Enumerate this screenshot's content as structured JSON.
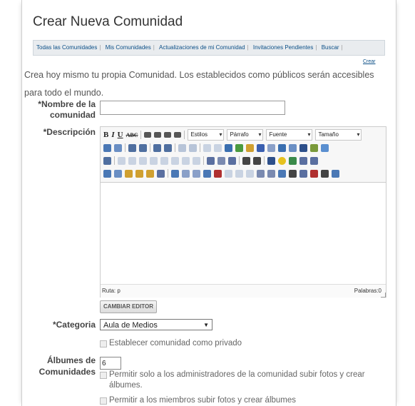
{
  "page": {
    "title": "Crear Nueva Comunidad",
    "tabs": [
      {
        "label": "Todas las Comunidades"
      },
      {
        "label": "Mis Comunidades"
      },
      {
        "label": "Actualizaciones de mi Comunidad"
      },
      {
        "label": "Invitaciones Pendientes"
      },
      {
        "label": "Buscar"
      }
    ],
    "crear_link": "Crear",
    "intro_line1": "Crea hoy mismo tu propia Comunidad. Los establecidos como públicos serán accesibles",
    "intro_line2": "para todo el mundo."
  },
  "form": {
    "name_label_1": "*Nombre de la",
    "name_label_2": "comunidad",
    "name_value": "",
    "description_label": "*Descripción",
    "editor": {
      "estilos": "Estilos",
      "parrafo": "Párrafo",
      "fuente": "Fuente",
      "tamano": "Tamaño",
      "ruta": "Ruta: p",
      "palabras": "Palabras:0"
    },
    "cambiar_editor": "CAMBIAR EDITOR",
    "categoria_label": "*Categoria",
    "categoria_value": "Aula de Medios",
    "privado_label": "Establecer comunidad como privado",
    "albumes_label_1": "Álbumes de",
    "albumes_label_2": "Comunidades",
    "albumes_value": "6",
    "admin_upload_label_1": "Permitir solo a los administradores de la comunidad subir fotos y crear",
    "admin_upload_label_2": "álbumes.",
    "members_upload_label": "Permitir a los miembros subir fotos y crear álbumes"
  },
  "colors": {
    "link": "#0b4f87",
    "tabbar_bg": "#e9ecef"
  }
}
